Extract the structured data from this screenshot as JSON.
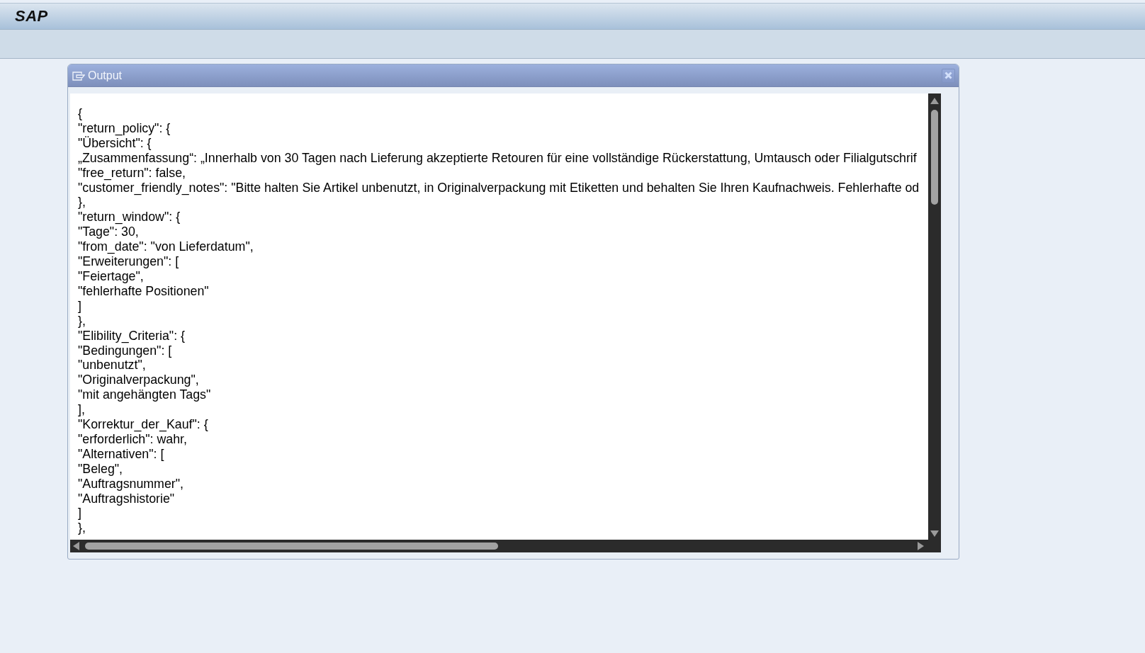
{
  "header": {
    "logo": "SAP"
  },
  "output_dialog": {
    "title": "Output",
    "lines": [
      "{",
      "\"return_policy\": {",
      "\"Übersicht\": {",
      "„Zusammenfassung“: „Innerhalb von 30 Tagen nach Lieferung akzeptierte Retouren für eine vollständige Rückerstattung, Umtausch oder Filialgutschrif",
      "\"free_return\": false,",
      "\"customer_friendly_notes\": \"Bitte halten Sie Artikel unbenutzt, in Originalverpackung mit Etiketten und behalten Sie Ihren Kaufnachweis. Fehlerhafte od",
      "},",
      "\"return_window\": {",
      "\"Tage\": 30,",
      "\"from_date\": \"von Lieferdatum\",",
      "\"Erweiterungen\": [",
      "\"Feiertage\",",
      "\"fehlerhafte Positionen\"",
      "]",
      "},",
      "\"Elibility_Criteria\": {",
      "\"Bedingungen\": [",
      "\"unbenutzt\",",
      "\"Originalverpackung\",",
      "\"mit angehängten Tags\"",
      "],",
      "\"Korrektur_der_Kauf\": {",
      "\"erforderlich\": wahr,",
      "\"Alternativen\": [",
      "\"Beleg\",",
      "\"Auftragsnummer\",",
      "\"Auftragshistorie\"",
      "]",
      "},"
    ]
  }
}
